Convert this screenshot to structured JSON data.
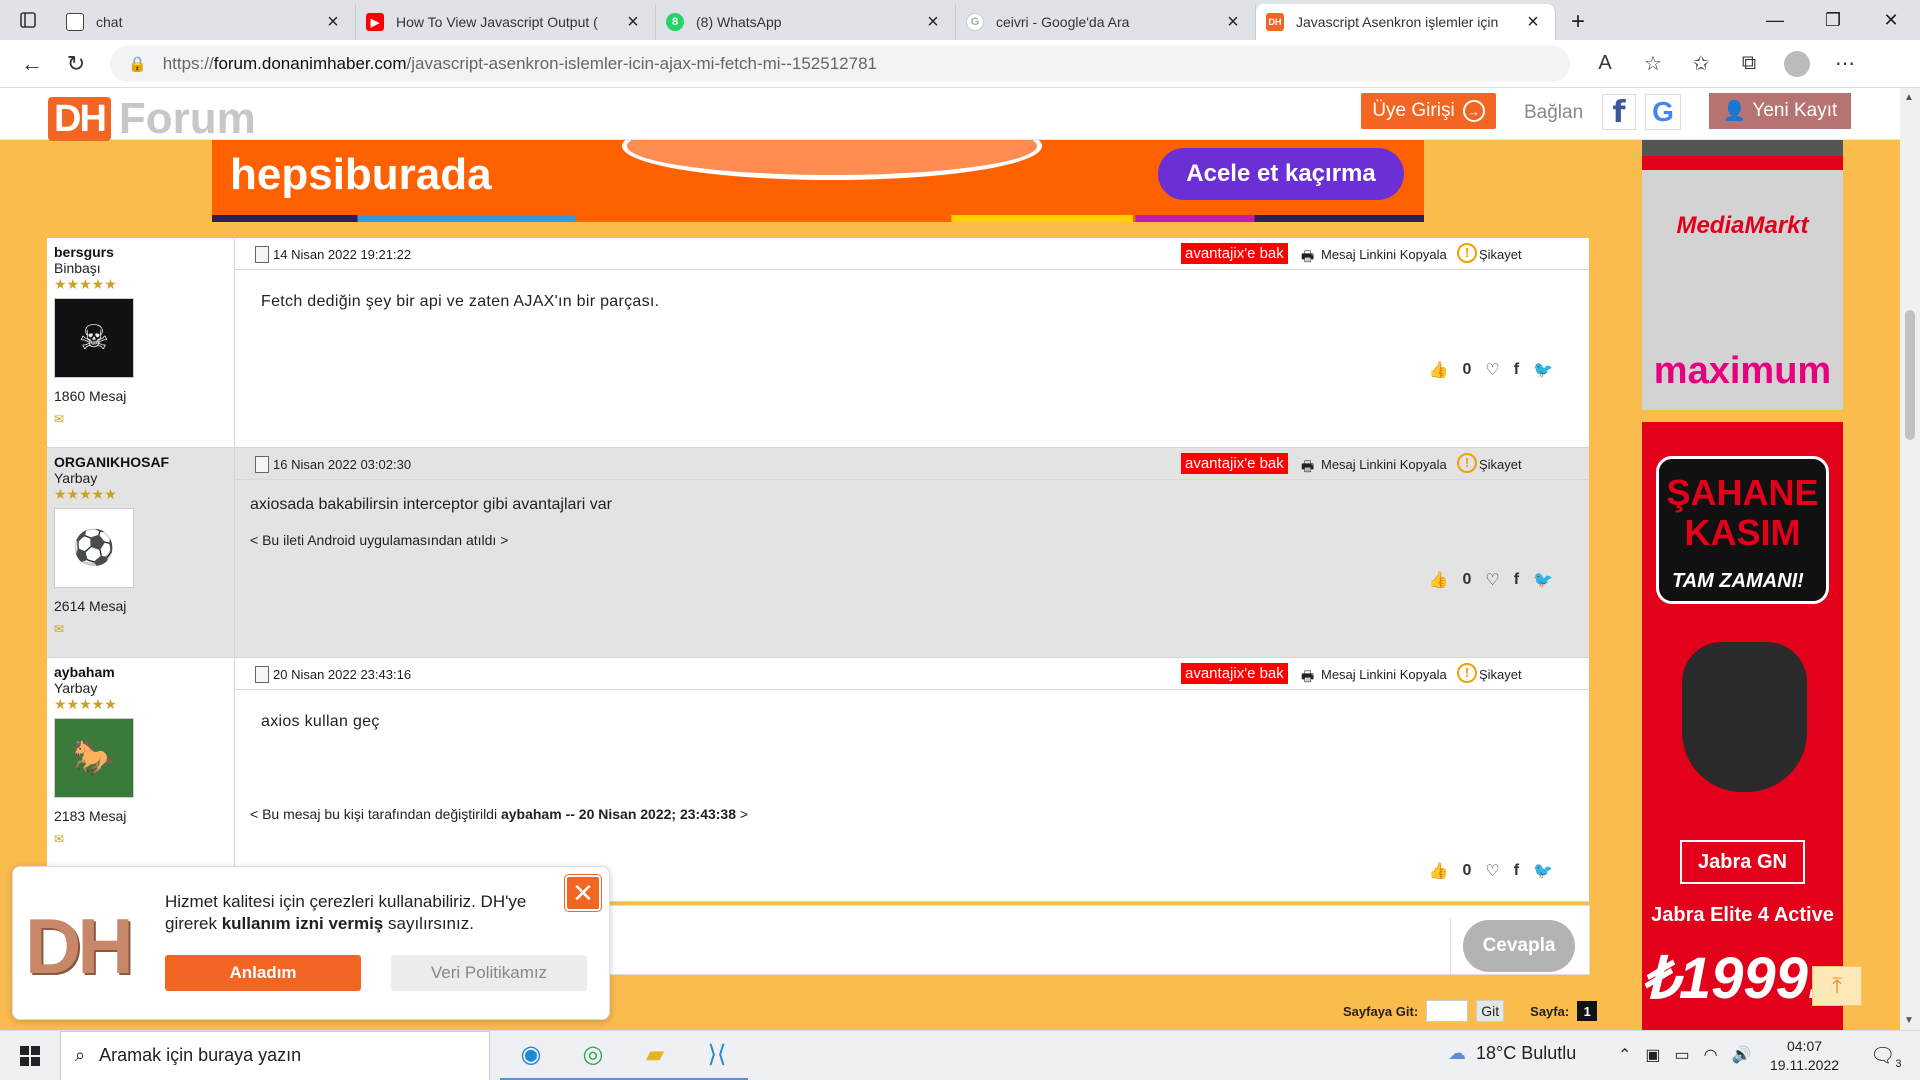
{
  "browser": {
    "tabs": [
      {
        "label": "chat",
        "icon": "page-icon"
      },
      {
        "label": "How To View Javascript Output (",
        "icon": "youtube-icon"
      },
      {
        "label": "(8) WhatsApp",
        "icon": "whatsapp-icon"
      },
      {
        "label": "ceivri - Google'da Ara",
        "icon": "google-icon"
      },
      {
        "label": "Javascript Asenkron işlemler için",
        "icon": "dh-icon",
        "active": true
      }
    ],
    "url_prefix": "https://",
    "url_host": "forum.donanimhaber.com",
    "url_path": "/javascript-asenkron-islemler-icin-ajax-mi-fetch-mi--152512781"
  },
  "site_header": {
    "logo_dh": "DH",
    "logo_forum": "Forum",
    "login_label": "Üye Girişi",
    "connect_label": "Bağlan",
    "facebook_glyph": "f",
    "google_glyph": "G",
    "register_label": "Yeni Kayıt"
  },
  "ads": {
    "top_brand": "hepsiburada",
    "top_cta": "Acele et kaçırma",
    "side1_brand1": "MediaMarkt",
    "side1_brand2": "maximum",
    "side2_headline": "ŞAHANE KASIM",
    "side2_sub": "TAM ZAMANI!",
    "side2_brand": "Jabra GN",
    "side2_product": "Jabra Elite 4 Active",
    "side2_price": "₺1999.-"
  },
  "posts": [
    {
      "username": "bersgurs",
      "rank": "Binbaşı",
      "stars": "★★★★★",
      "message_count": "1860 Mesaj",
      "avatar_glyph": "☠",
      "date": "14 Nisan 2022 19:21:22",
      "body": "Fetch dediğin şey bir api ve zaten AJAX'ın bir parçası.",
      "likes": "0"
    },
    {
      "username": "ORGANIKHOSAF",
      "rank": "Yarbay",
      "stars": "★★★★★",
      "message_count": "2614 Mesaj",
      "avatar_glyph": "⚽",
      "date": "16 Nisan 2022 03:02:30",
      "body": "axiosada bakabilirsin interceptor gibi avantajlari var",
      "note": "< Bu ileti Android uygulamasından atıldı >",
      "likes": "0"
    },
    {
      "username": "aybaham",
      "rank": "Yarbay",
      "stars": "★★★★★",
      "message_count": "2183 Mesaj",
      "avatar_glyph": "🐎",
      "date": "20 Nisan 2022 23:43:16",
      "body": "axios kullan geç",
      "edit_prefix": "< Bu mesaj bu kişi tarafından değiştirildi",
      "edit_user": "aybaham",
      "edit_sep": "--",
      "edit_date": "20 Nisan 2022; 23:43:38",
      "edit_suffix": ">",
      "likes": "0"
    }
  ],
  "post_actions": {
    "avantajix": "avantajix'e bak",
    "copy_link": "Mesaj Linkini Kopyala",
    "report": "Şikayet"
  },
  "reply": {
    "button": "Cevapla"
  },
  "pager": {
    "goto_label": "Sayfaya Git:",
    "go_button": "Git",
    "page_label": "Sayfa:",
    "page_number": "1"
  },
  "cookie": {
    "logo": "DH",
    "text_part1": "Hizmet kalitesi için çerezleri kullanabiliriz. DH'ye girerek",
    "text_bold": "kullanım izni vermiş",
    "text_part2": "sayılırsınız.",
    "accept": "Anladım",
    "policy": "Veri Politikamız"
  },
  "taskbar": {
    "search_placeholder": "Aramak için buraya yazın",
    "weather": "18°C  Bulutlu",
    "time": "04:07",
    "date": "19.11.2022",
    "notifications": "3"
  }
}
